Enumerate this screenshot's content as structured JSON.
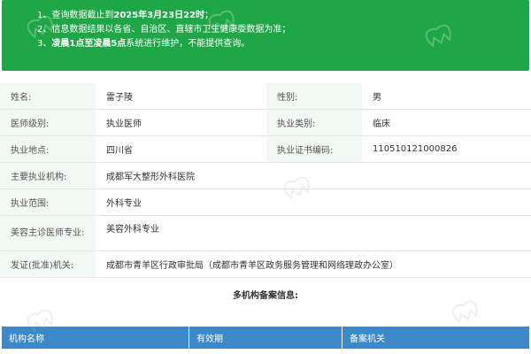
{
  "notice": {
    "line1_prefix": "1、查询数据截止到",
    "line1_bold": "2025年3月23日22时",
    "line1_suffix": "；",
    "line2": "2、信息数据结果以各省、自治区、直辖市卫生健康委数据为准；",
    "line3_prefix": "3、",
    "line3_bold": "凌晨1点至凌晨5点",
    "line3_suffix": "系统进行维护，不能提供查询。"
  },
  "info": {
    "name_label": "姓名:",
    "name_value": "雷子陵",
    "gender_label": "性别:",
    "gender_value": "男",
    "level_label": "医师级别:",
    "level_value": "执业医师",
    "category_label": "执业类别:",
    "category_value": "临床",
    "location_label": "执业地点:",
    "location_value": "四川省",
    "cert_label": "执业证书编码:",
    "cert_value": "110510121000826",
    "institution_label": "主要执业机构:",
    "institution_value": "成都军大整形外科医院",
    "scope_label": "执业范围:",
    "scope_value": "外科专业",
    "cosmetic_label": "美容主诊医师专业:",
    "cosmetic_value": "美容外科专业",
    "issuer_label": "发证(批准)机关:",
    "issuer_value": "成都市青羊区行政审批局（成都市青羊区政务服务管理和网络理政办公室）"
  },
  "multi_section": {
    "title": "多机构备案信息:",
    "columns": [
      "机构名称",
      "有效期",
      "备案机关"
    ]
  },
  "colors": {
    "notice_bg": "#1fa646",
    "label_bg": "#f2f8f3",
    "table_header_bg": "#3d88c7"
  },
  "watermark_icon": "tooth-logo-icon"
}
